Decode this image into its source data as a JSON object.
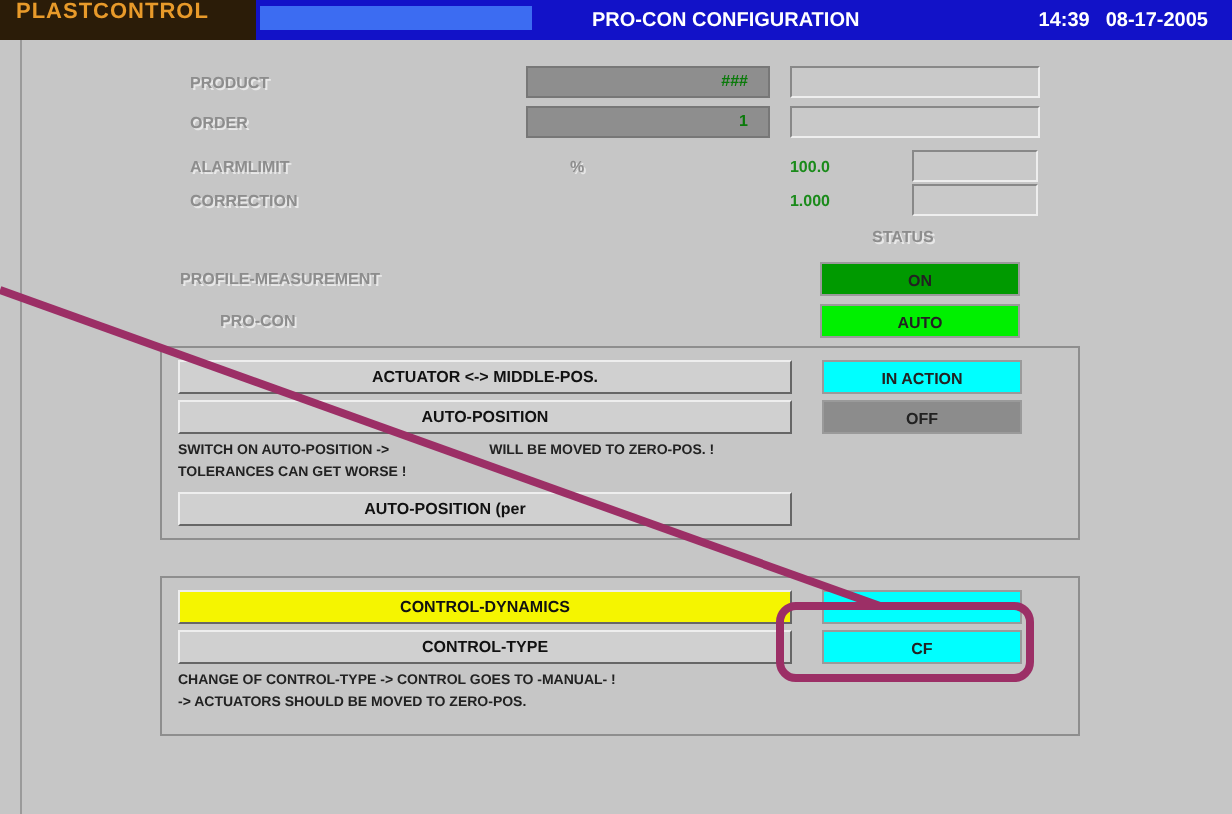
{
  "header": {
    "logo": "PLASTCONTROL",
    "title": "PRO-CON CONFIGURATION",
    "time": "14:39",
    "date": "08-17-2005"
  },
  "fields": [
    {
      "label": "PRODUCT",
      "value": "###"
    },
    {
      "label": "ORDER",
      "value": "1"
    }
  ],
  "parameters": [
    {
      "label": "ALARMLIMIT",
      "unit": "%",
      "value": "100.0"
    },
    {
      "label": "CORRECTION",
      "value": "1.000"
    }
  ],
  "status_heading": "STATUS",
  "statuses": [
    {
      "label": "PROFILE-MEASUREMENT",
      "indented": false,
      "state": "ON",
      "color": "#009a00"
    },
    {
      "label": "PRO-CON",
      "indented": true,
      "state": "AUTO",
      "color": "#00f000"
    }
  ],
  "actuator_group": {
    "rows": [
      {
        "button": "ACTUATOR <-> MIDDLE-POS.",
        "state": "IN ACTION",
        "color": "#00ffff"
      },
      {
        "button": "AUTO-POSITION",
        "state": "OFF",
        "color": "#8c8c8c"
      }
    ],
    "notes": [
      [
        "SWITCH ON AUTO-POSITION ->",
        "WILL BE MOVED TO ZERO-POS. !"
      ],
      [
        "TOLERANCES CAN GET WORSE !"
      ]
    ],
    "button": "AUTO-POSITION (per"
  },
  "control_group": {
    "rows": [
      {
        "button": "CONTROL-DYNAMICS",
        "highlighted": true,
        "color": "#00ffff"
      },
      {
        "button": "CONTROL-TYPE",
        "highlighted": false,
        "state": "CF",
        "color": "#00ffff"
      }
    ],
    "notes": [
      [
        "CHANGE OF CONTROL-TYPE -> CONTROL GOES TO -MANUAL- !"
      ],
      [
        "-> ACTUATORS SHOULD BE MOVED TO ZERO-POS."
      ]
    ]
  }
}
